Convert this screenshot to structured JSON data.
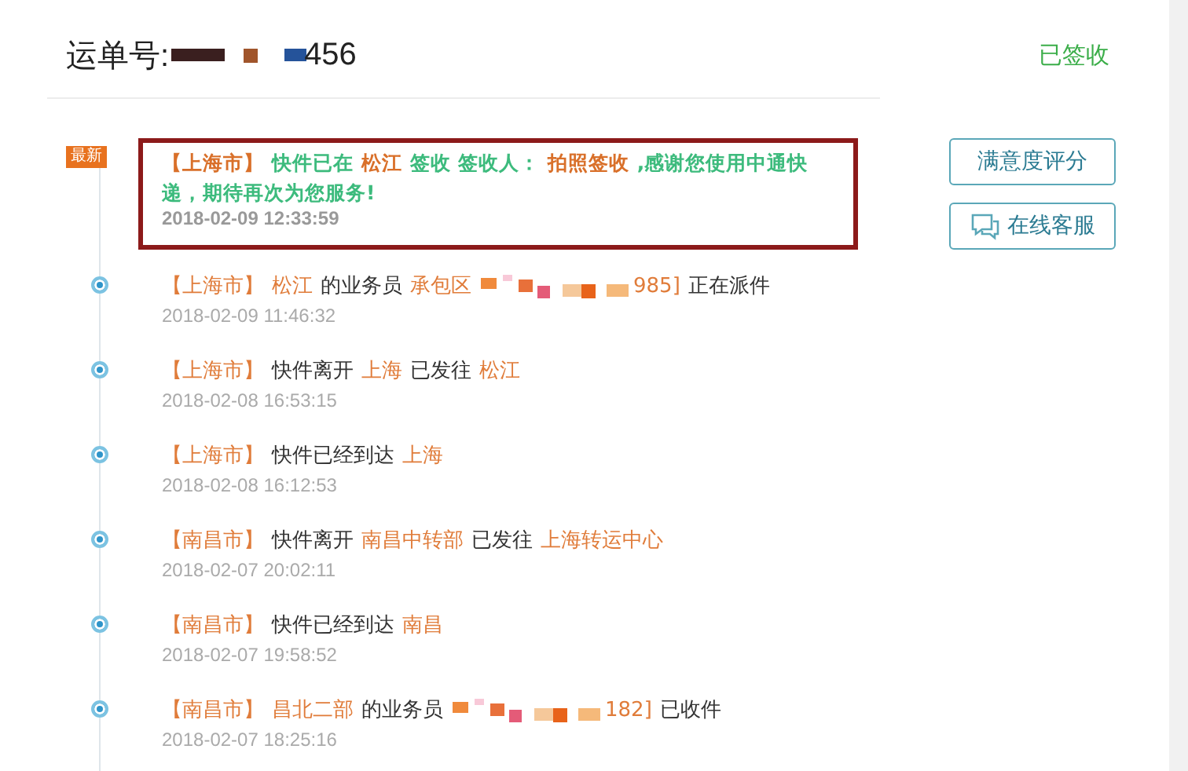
{
  "header": {
    "label": "运单号:",
    "number_tail": "456",
    "status": "已签收"
  },
  "buttons": [
    {
      "kind": "rate",
      "label": "满意度评分"
    },
    {
      "kind": "service",
      "label": "在线客服"
    }
  ],
  "events": [
    {
      "latest": true,
      "badge": "最新",
      "parts": [
        {
          "kind": "city",
          "text": "【上海市】"
        },
        {
          "kind": "text",
          "text": "快件已在"
        },
        {
          "kind": "place",
          "text": "松江"
        },
        {
          "kind": "text",
          "text": "签收 签收人："
        },
        {
          "kind": "place",
          "text": "拍照签收"
        },
        {
          "kind": "text",
          "text": ",感谢您使用中通快递，期待再次为您服务!"
        }
      ],
      "time": "2018-02-09 12:33:59"
    },
    {
      "latest": false,
      "parts": [
        {
          "kind": "city",
          "text": "【上海市】"
        },
        {
          "kind": "place",
          "text": "松江"
        },
        {
          "kind": "text",
          "text": "的业务员"
        },
        {
          "kind": "place",
          "text": "承包区"
        },
        {
          "kind": "redacted"
        },
        {
          "kind": "place",
          "text": "985]"
        },
        {
          "kind": "text",
          "text": "正在派件"
        }
      ],
      "time": "2018-02-09 11:46:32"
    },
    {
      "latest": false,
      "parts": [
        {
          "kind": "city",
          "text": "【上海市】"
        },
        {
          "kind": "text",
          "text": "快件离开"
        },
        {
          "kind": "place",
          "text": "上海"
        },
        {
          "kind": "text",
          "text": "已发往"
        },
        {
          "kind": "place",
          "text": "松江"
        }
      ],
      "time": "2018-02-08 16:53:15"
    },
    {
      "latest": false,
      "parts": [
        {
          "kind": "city",
          "text": "【上海市】"
        },
        {
          "kind": "text",
          "text": "快件已经到达"
        },
        {
          "kind": "place",
          "text": "上海"
        }
      ],
      "time": "2018-02-08 16:12:53"
    },
    {
      "latest": false,
      "parts": [
        {
          "kind": "city",
          "text": "【南昌市】"
        },
        {
          "kind": "text",
          "text": "快件离开"
        },
        {
          "kind": "place",
          "text": "南昌中转部"
        },
        {
          "kind": "text",
          "text": "已发往"
        },
        {
          "kind": "place",
          "text": "上海转运中心"
        }
      ],
      "time": "2018-02-07 20:02:11"
    },
    {
      "latest": false,
      "parts": [
        {
          "kind": "city",
          "text": "【南昌市】"
        },
        {
          "kind": "text",
          "text": "快件已经到达"
        },
        {
          "kind": "place",
          "text": "南昌"
        }
      ],
      "time": "2018-02-07 19:58:52"
    },
    {
      "latest": false,
      "parts": [
        {
          "kind": "city",
          "text": "【南昌市】"
        },
        {
          "kind": "place",
          "text": "昌北二部"
        },
        {
          "kind": "text",
          "text": "的业务员"
        },
        {
          "kind": "redacted"
        },
        {
          "kind": "place",
          "text": "182]"
        },
        {
          "kind": "text",
          "text": "已收件"
        }
      ],
      "time": "2018-02-07 18:25:16"
    }
  ]
}
